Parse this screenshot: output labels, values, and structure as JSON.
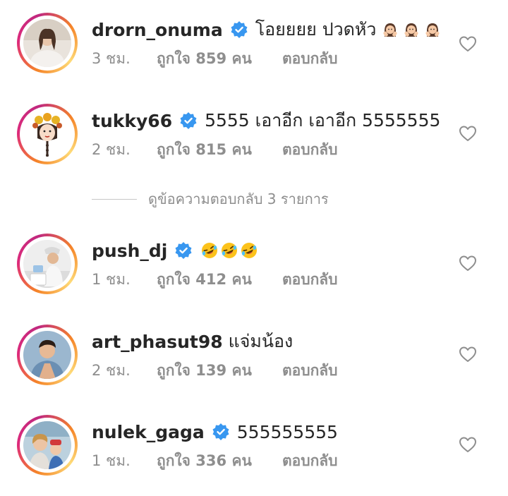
{
  "colors": {
    "text_primary": "#262626",
    "text_secondary": "#8e8e8e",
    "verified_blue": "#3897f0",
    "story_ring": "instagram-gradient"
  },
  "comments": [
    {
      "username": "drorn_onuma",
      "verified": true,
      "text": "โอยยยย ปวดหัว",
      "emojis": [
        "woman-gesturing-no-icon",
        "woman-gesturing-no-icon",
        "woman-gesturing-no-icon"
      ],
      "time": "3 ชม.",
      "likes": "ถูกใจ 859 คน",
      "reply": "ตอบกลับ"
    },
    {
      "username": "tukky66",
      "verified": true,
      "text": "5555 เอาอีก เอาอีก 5555555",
      "emojis": [],
      "time": "2 ชม.",
      "likes": "ถูกใจ 815 คน",
      "reply": "ตอบกลับ"
    },
    {
      "username": "push_dj",
      "verified": true,
      "text": "",
      "emojis": [
        "rolling-on-floor-laughing-icon",
        "rolling-on-floor-laughing-icon",
        "rolling-on-floor-laughing-icon"
      ],
      "time": "1 ชม.",
      "likes": "ถูกใจ 412 คน",
      "reply": "ตอบกลับ"
    },
    {
      "username": "art_phasut98",
      "verified": false,
      "text": "แจ่มน้อง",
      "emojis": [],
      "time": "2 ชม.",
      "likes": "ถูกใจ 139 คน",
      "reply": "ตอบกลับ"
    },
    {
      "username": "nulek_gaga",
      "verified": true,
      "text": "555555555",
      "emojis": [],
      "time": "1 ชม.",
      "likes": "ถูกใจ 336 คน",
      "reply": "ตอบกลับ"
    }
  ],
  "replies_toggle": "ดูข้อความตอบกลับ 3 รายการ",
  "icons": {
    "like": "heart-outline-icon",
    "verified": "verified-badge-icon"
  }
}
